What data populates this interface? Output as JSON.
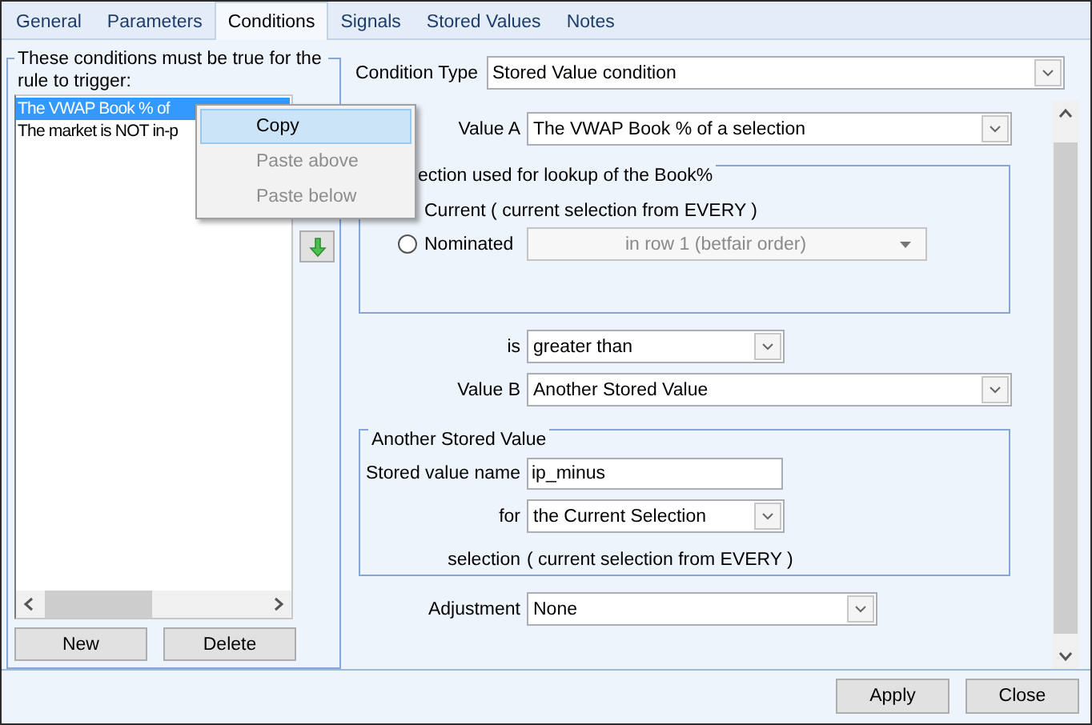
{
  "tabs": [
    {
      "label": "General",
      "selected": false
    },
    {
      "label": "Parameters",
      "selected": false
    },
    {
      "label": "Conditions",
      "selected": true
    },
    {
      "label": "Signals",
      "selected": false
    },
    {
      "label": "Stored Values",
      "selected": false
    },
    {
      "label": "Notes",
      "selected": false
    }
  ],
  "conditions_panel": {
    "legend": "These conditions must be true for the rule to trigger:",
    "items": [
      {
        "text": "The VWAP Book % of",
        "selected": true
      },
      {
        "text": "The market is NOT in-p",
        "selected": false
      }
    ],
    "buttons": [
      "New",
      "Delete"
    ]
  },
  "context_menu": [
    {
      "label": "Copy",
      "highlighted": true,
      "disabled": false
    },
    {
      "label": "Paste above",
      "highlighted": false,
      "disabled": true
    },
    {
      "label": "Paste below",
      "highlighted": false,
      "disabled": true
    }
  ],
  "condition_type": {
    "label": "Condition Type",
    "value": "Stored Value condition"
  },
  "value_a": {
    "label": "Value A",
    "value": "The VWAP Book % of a selection"
  },
  "lookup_group": {
    "legend": "ection used for lookup of the Book%",
    "options": [
      {
        "label": "Current ( current selection from EVERY )"
      },
      {
        "label": "Nominated",
        "selected": false,
        "dropdown": "in row 1 (betfair order)",
        "disabled": true
      }
    ]
  },
  "comparison": {
    "label": "is",
    "value": "greater than"
  },
  "value_b": {
    "label": "Value B",
    "value": "Another Stored Value"
  },
  "stored_group": {
    "legend": "Another Stored Value",
    "name_label": "Stored value name",
    "name_value": "ip_minus",
    "for_label": "for",
    "for_value": "the Current Selection",
    "selection_label": "selection",
    "selection_value": "( current selection from EVERY )"
  },
  "adjustment": {
    "label": "Adjustment",
    "value": "None"
  },
  "buttons": [
    "Apply",
    "Close"
  ]
}
